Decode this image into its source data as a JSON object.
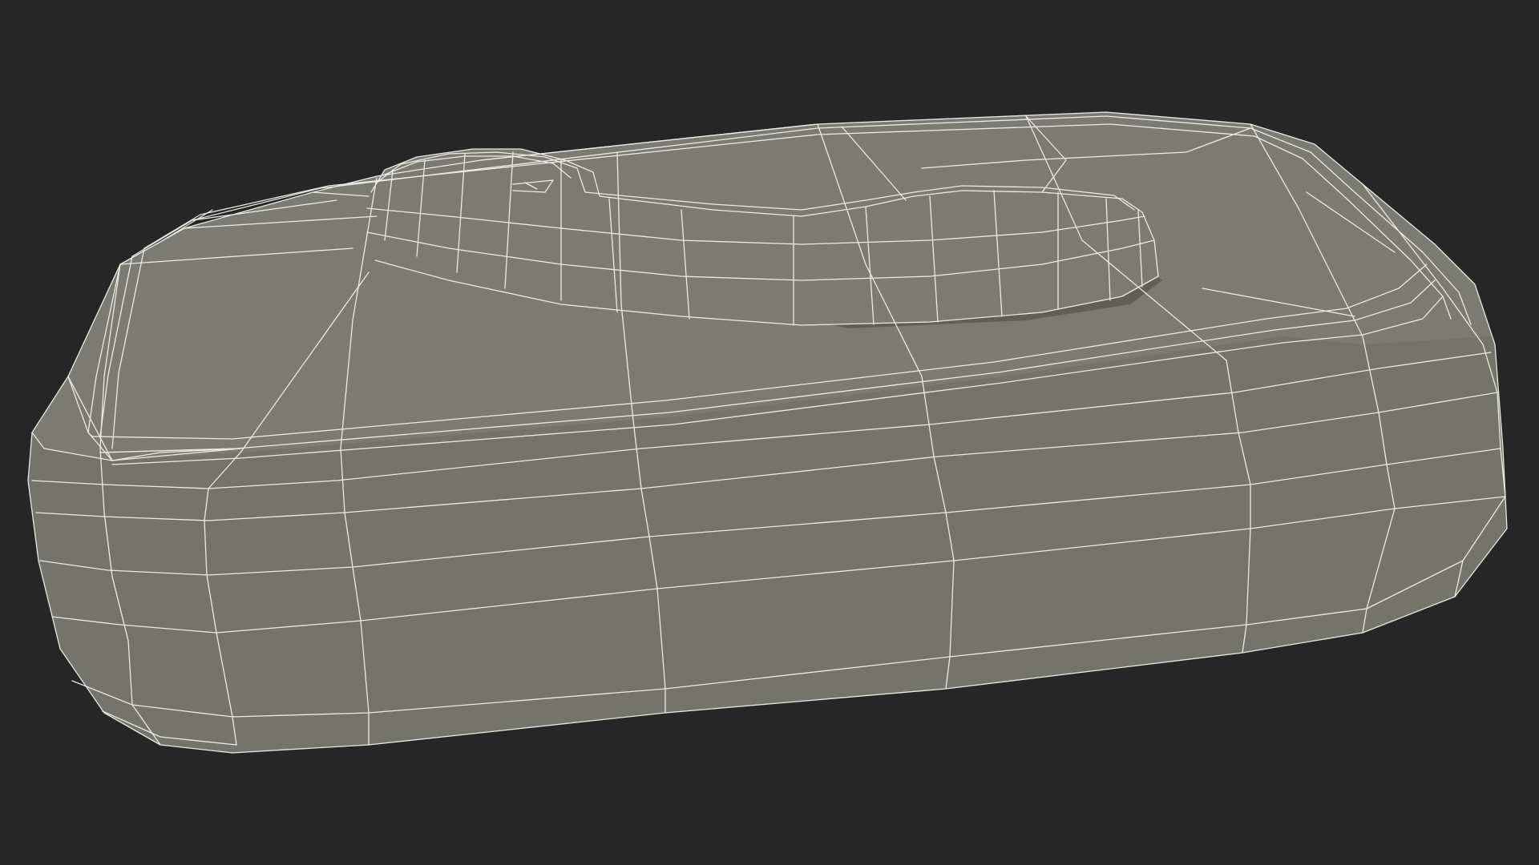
{
  "scene": {
    "subject": "wireframe-mesh",
    "colors": {
      "background": "#262626",
      "surface_top": "#7b7b72",
      "surface_side": "#74746b",
      "surface_shadow": "#5f5f57",
      "wire": "#f2f2ea"
    }
  }
}
